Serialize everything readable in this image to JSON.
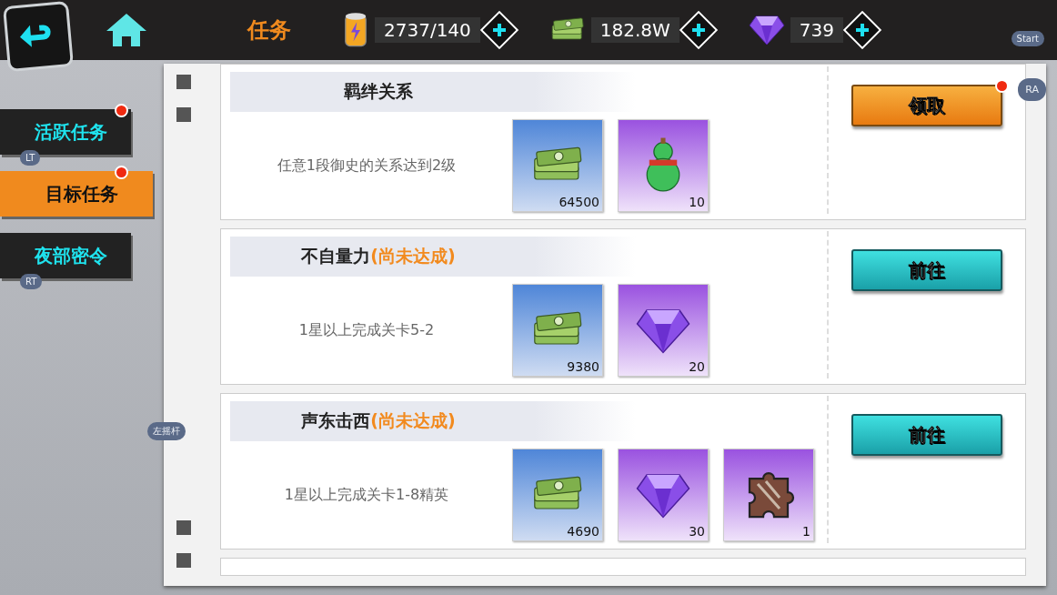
{
  "header": {
    "title": "任务",
    "resources": [
      {
        "kind": "energy",
        "value": "2737/140"
      },
      {
        "kind": "cash",
        "value": "182.8W"
      },
      {
        "kind": "gem",
        "value": "739"
      }
    ]
  },
  "hints": {
    "start": "Start",
    "ra": "RA",
    "stick": "左摇杆"
  },
  "tabs": [
    {
      "label": "活跃任务",
      "selected": false,
      "badge": true,
      "hint": "LT"
    },
    {
      "label": "目标任务",
      "selected": true,
      "badge": true
    },
    {
      "label": "夜部密令",
      "selected": false,
      "badge": false,
      "hint": "RT"
    }
  ],
  "tasks": [
    {
      "title": "羁绊关系",
      "description": "任意1段御史的关系达到2级",
      "rewards": [
        {
          "kind": "cash",
          "count": "64500"
        },
        {
          "kind": "gourd",
          "count": "10"
        }
      ],
      "button": {
        "kind": "claim",
        "label": "领取",
        "badge": true
      }
    },
    {
      "title": "不自量力",
      "status": "(尚未达成)",
      "description": "1星以上完成关卡5-2",
      "rewards": [
        {
          "kind": "cash",
          "count": "9380"
        },
        {
          "kind": "gem",
          "count": "20"
        }
      ],
      "button": {
        "kind": "go",
        "label": "前往",
        "badge": false
      }
    },
    {
      "title": "声东击西",
      "status": "(尚未达成)",
      "description": "1星以上完成关卡1-8精英",
      "rewards": [
        {
          "kind": "cash",
          "count": "4690"
        },
        {
          "kind": "gem",
          "count": "30"
        },
        {
          "kind": "puzzle",
          "count": "1"
        }
      ],
      "button": {
        "kind": "go",
        "label": "前往",
        "badge": false
      }
    }
  ]
}
